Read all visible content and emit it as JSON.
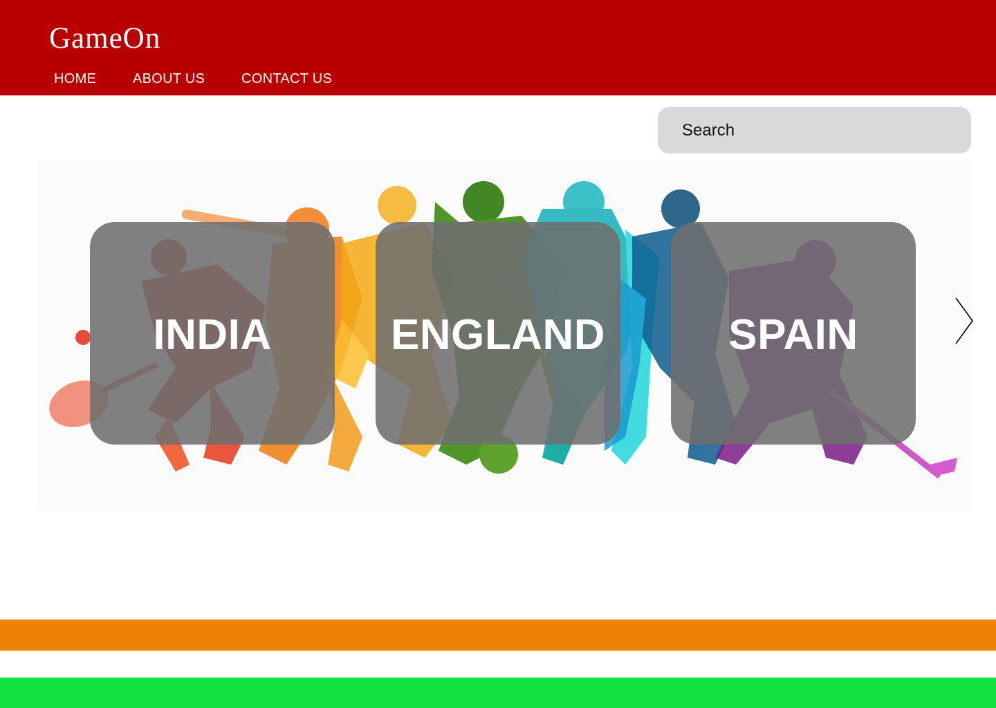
{
  "header": {
    "logo": "GameOn",
    "nav": [
      {
        "label": "HOME"
      },
      {
        "label": "ABOUT US"
      },
      {
        "label": "CONTACT US"
      }
    ]
  },
  "search": {
    "placeholder": "Search",
    "value": ""
  },
  "hero": {
    "image_icon": "sports-silhouettes-image",
    "cards": [
      {
        "label": "INDIA"
      },
      {
        "label": "ENGLAND"
      },
      {
        "label": "SPAIN"
      }
    ],
    "next_icon": "chevron-right-icon"
  },
  "colors": {
    "header": "#b90000",
    "search_bg": "#d9d9d9",
    "card_overlay": "#6e6e6e",
    "stripe_orange": "#ee8206",
    "stripe_green": "#12e041"
  }
}
